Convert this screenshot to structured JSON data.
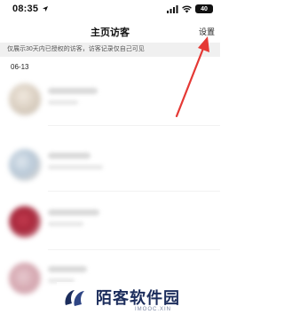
{
  "status_bar": {
    "time": "08:35",
    "battery": "40"
  },
  "nav": {
    "title": "主页访客",
    "settings": "设置"
  },
  "notice": "仅展示30天内已授权的访客，访客记录仅自己可见",
  "date_group": "06-13",
  "colors": {
    "arrow": "#e53935",
    "watermark": "#1c2d5c"
  },
  "icons": [
    "location-arrow-icon",
    "signal-icon",
    "wifi-icon",
    "battery-icon"
  ],
  "watermark": {
    "text": "陌客软件园",
    "sub": "IMOOC.XIN"
  }
}
